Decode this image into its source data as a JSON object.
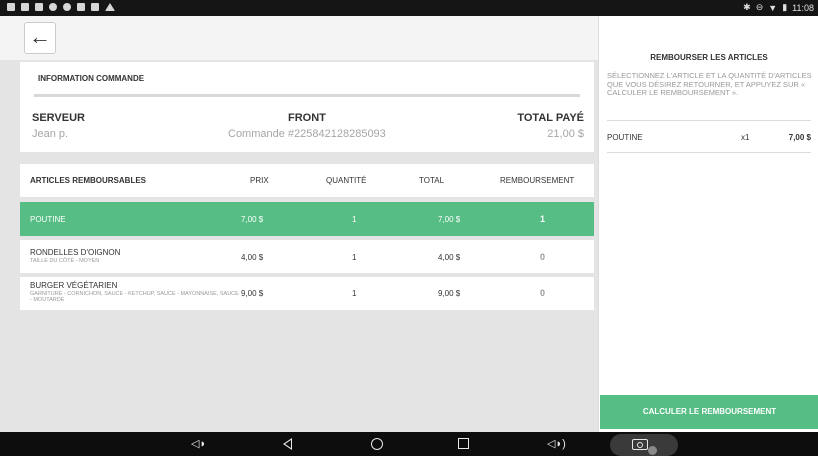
{
  "status_bar": {
    "left_icons": [
      "media-icon",
      "image-icon",
      "image-icon",
      "sync-icon",
      "cloud-icon",
      "usb-icon",
      "usb-icon",
      "warning-icon"
    ],
    "time": "11:08"
  },
  "header": {
    "back_icon": "arrow-left-icon"
  },
  "info": {
    "title": "INFORMATION COMMANDE",
    "server_label": "SERVEUR",
    "server_value": "Jean p.",
    "order_label": "FRONT",
    "order_value": "Commande #225842128285093",
    "total_label": "TOTAL PAYÉ",
    "total_value": "21,00 $"
  },
  "refund_table": {
    "columns": [
      "ARTICLES REMBOURSABLES",
      "PRIX",
      "QUANTITÉ",
      "TOTAL",
      "REMBOURSEMENT"
    ],
    "rows": [
      {
        "name": "POUTINE",
        "details": "",
        "price": "7,00 $",
        "qty": "1",
        "total": "7,00 $",
        "refund": "1",
        "selected": true
      },
      {
        "name": "RONDELLES D'OIGNON",
        "details": "TAILLE DU CÔTÉ - MOYEN",
        "price": "4,00 $",
        "qty": "1",
        "total": "4,00 $",
        "refund": "0",
        "selected": false
      },
      {
        "name": "BURGER VÉGÉTARIEN",
        "details": "GARNITURE - CORNICHON, SAUCE - KETCHUP, SAUCE - MAYONNAISE, SAUCE - MOUTARDE",
        "price": "9,00 $",
        "qty": "1",
        "total": "9,00 $",
        "refund": "0",
        "selected": false
      }
    ]
  },
  "right_panel": {
    "title": "REMBOURSER LES ARTICLES",
    "instructions": "SÉLECTIONNEZ L'ARTICLE ET LA QUANTITÉ D'ARTICLES QUE VOUS DÉSIREZ RETOURNER, ET APPUYEZ SUR « CALCULER LE REMBOURSEMENT ».",
    "item": {
      "name": "POUTINE",
      "qty": "x1",
      "price": "7,00 $"
    },
    "calculate_label": "CALCULER LE REMBOURSEMENT"
  },
  "colors": {
    "accent": "#56bd84",
    "background": "#e4e4e4",
    "muted_text": "#999999"
  }
}
